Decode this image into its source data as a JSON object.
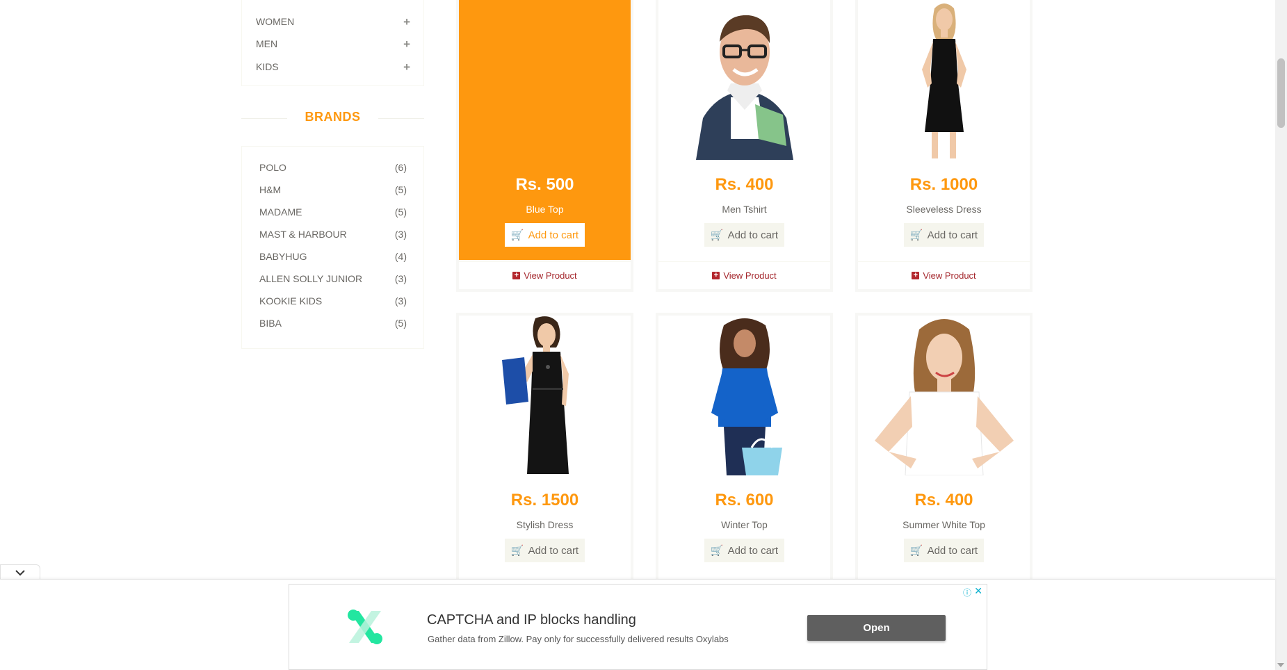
{
  "sidebar": {
    "categories": [
      {
        "label": "WOMEN"
      },
      {
        "label": "MEN"
      },
      {
        "label": "KIDS"
      }
    ],
    "brands_title": "BRANDS",
    "brands": [
      {
        "name": "POLO",
        "count": "(6)"
      },
      {
        "name": "H&M",
        "count": "(5)"
      },
      {
        "name": "MADAME",
        "count": "(5)"
      },
      {
        "name": "MAST & HARBOUR",
        "count": "(3)"
      },
      {
        "name": "BABYHUG",
        "count": "(4)"
      },
      {
        "name": "ALLEN SOLLY JUNIOR",
        "count": "(3)"
      },
      {
        "name": "KOOKIE KIDS",
        "count": "(3)"
      },
      {
        "name": "BIBA",
        "count": "(5)"
      }
    ]
  },
  "products": [
    {
      "price": "Rs. 500",
      "name": "Blue Top",
      "cart_label": "Add to cart",
      "view_label": "View Product"
    },
    {
      "price": "Rs. 400",
      "name": "Men Tshirt",
      "cart_label": "Add to cart",
      "view_label": "View Product"
    },
    {
      "price": "Rs. 1000",
      "name": "Sleeveless Dress",
      "cart_label": "Add to cart",
      "view_label": "View Product"
    },
    {
      "price": "Rs. 1500",
      "name": "Stylish Dress",
      "cart_label": "Add to cart"
    },
    {
      "price": "Rs. 600",
      "name": "Winter Top",
      "cart_label": "Add to cart"
    },
    {
      "price": "Rs. 400",
      "name": "Summer White Top",
      "cart_label": "Add to cart"
    }
  ],
  "ad": {
    "title": "CAPTCHA and IP blocks handling",
    "description": "Gather data from Zillow. Pay only for successfully delivered results Oxylabs",
    "button_label": "Open",
    "info_icon": "info-icon",
    "close_icon": "close-icon"
  },
  "colors": {
    "accent": "#fe980f",
    "view_product": "#a4262c",
    "ad_button": "#5f5f5f"
  }
}
